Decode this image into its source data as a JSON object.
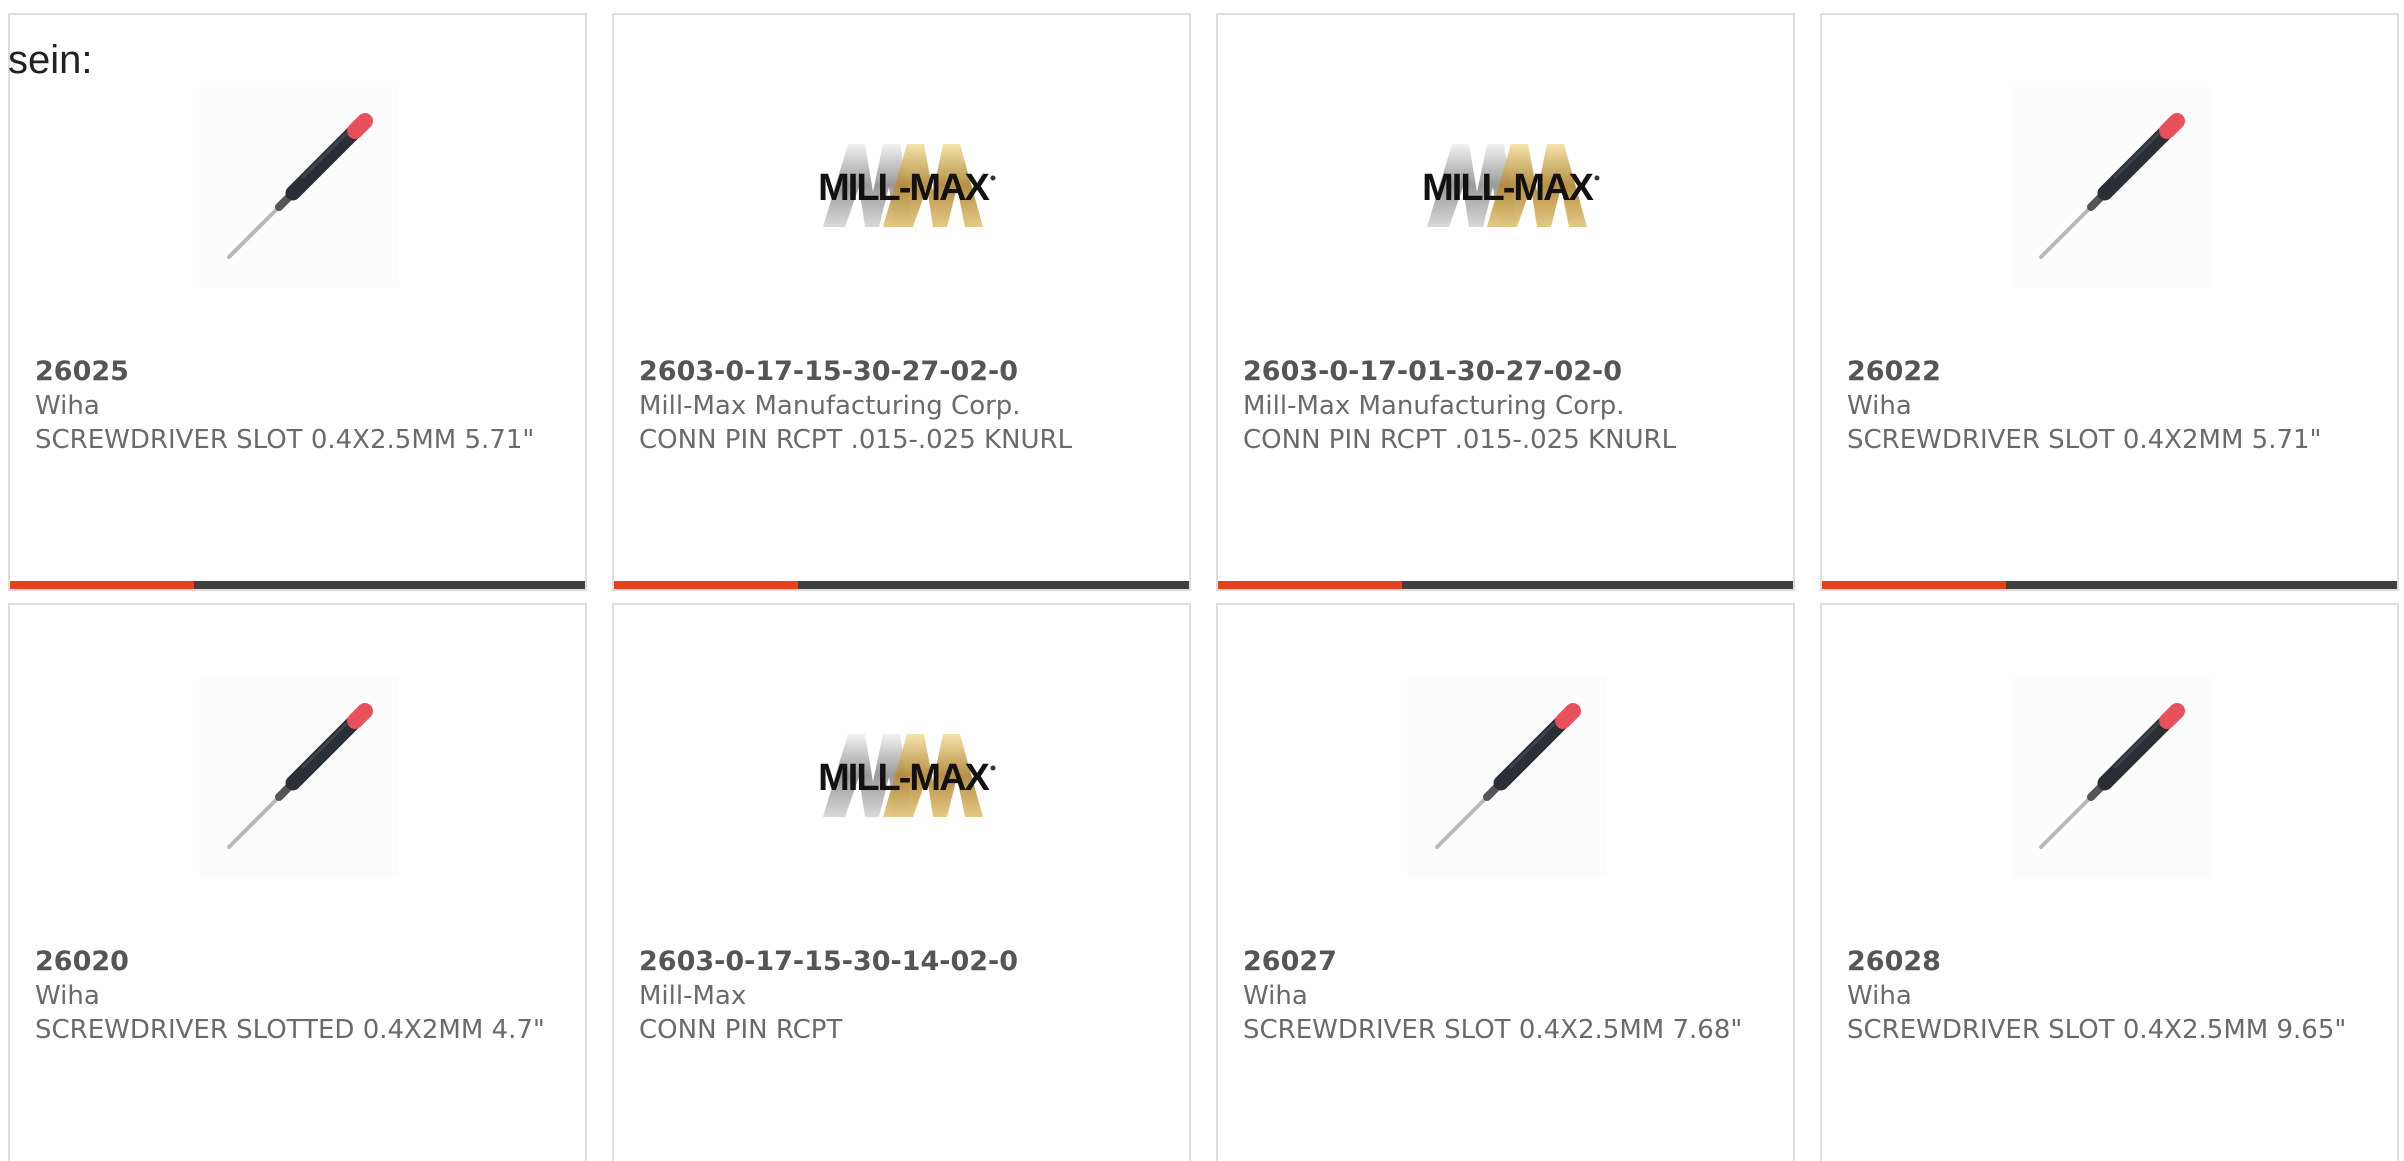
{
  "intro_text": "sein:",
  "colors": {
    "accent": "#e8401c",
    "track": "#404040",
    "card_border": "#dddddd",
    "text": "#6a6a6a"
  },
  "products": [
    {
      "part_number": "26025",
      "manufacturer": "Wiha",
      "description": "SCREWDRIVER SLOT 0.4X2.5MM 5.71\"",
      "image": "screwdriver-image",
      "progress": 0.32
    },
    {
      "part_number": "2603-0-17-15-30-27-02-0",
      "manufacturer": "Mill-Max Manufacturing Corp.",
      "description": "CONN PIN RCPT .015-.025 KNURL",
      "image": "mill-max-logo",
      "logo_text": "MILL-MAX",
      "progress": 0.32
    },
    {
      "part_number": "2603-0-17-01-30-27-02-0",
      "manufacturer": "Mill-Max Manufacturing Corp.",
      "description": "CONN PIN RCPT .015-.025 KNURL",
      "image": "mill-max-logo",
      "logo_text": "MILL-MAX",
      "progress": 0.32
    },
    {
      "part_number": "26022",
      "manufacturer": "Wiha",
      "description": "SCREWDRIVER SLOT 0.4X2MM 5.71\"",
      "image": "screwdriver-image",
      "progress": 0.32
    },
    {
      "part_number": "26020",
      "manufacturer": "Wiha",
      "description": "SCREWDRIVER SLOTTED 0.4X2MM 4.7\"",
      "image": "screwdriver-image",
      "progress": null
    },
    {
      "part_number": "2603-0-17-15-30-14-02-0",
      "manufacturer": "Mill-Max",
      "description": "CONN PIN RCPT",
      "image": "mill-max-logo",
      "logo_text": "MILL-MAX",
      "progress": null
    },
    {
      "part_number": "26027",
      "manufacturer": "Wiha",
      "description": "SCREWDRIVER SLOT 0.4X2.5MM 7.68\"",
      "image": "screwdriver-image",
      "progress": null
    },
    {
      "part_number": "26028",
      "manufacturer": "Wiha",
      "description": "SCREWDRIVER SLOT 0.4X2.5MM 9.65\"",
      "image": "screwdriver-image",
      "progress": null
    }
  ]
}
